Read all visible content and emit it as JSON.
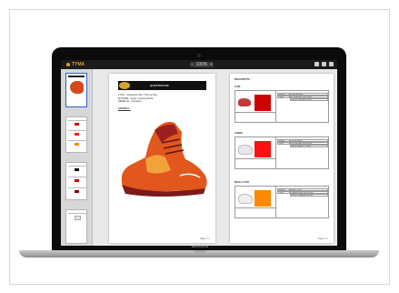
{
  "device": {
    "brand_label": "MacBook"
  },
  "app": {
    "logo_text": "TYMA",
    "zoom_controls": [
      "−",
      "100%",
      "+"
    ],
    "colors": {
      "topbar": "#1b1b1b",
      "accent": "#d6a32b"
    }
  },
  "sidebar": {
    "thumbnails": [
      {
        "kind": "cover"
      },
      {
        "kind": "colorway",
        "swatches": [
          "#d40000",
          "#ff1a1a",
          "#ff8c00"
        ]
      },
      {
        "kind": "colorway",
        "swatches": [
          "#000000",
          "#d40000",
          "#8b0000"
        ]
      },
      {
        "kind": "colorway",
        "swatches": [
          "#e6e6e6"
        ]
      }
    ]
  },
  "page1": {
    "title": "QUESTION M2",
    "description": "TYPE : Chaussure trail / Trail running\nMATIERE : Upper mesh/synthetic\nSEMELLE : Contagrip",
    "section": "APERÇU :",
    "footer": "Page 1 / 2",
    "shoe_colors": [
      "#e2571d",
      "#9b1f1f",
      "#f2a23a"
    ]
  },
  "page2": {
    "heading": "DESCRIPTIF :",
    "footer": "Page 2 / 2",
    "colorways": [
      {
        "label": "CUIR",
        "swatch": "#d10000",
        "shoe": "#c23a3a",
        "rows": [
          [
            "Matériau",
            "CUIR NATUREL"
          ],
          [
            "Coloris",
            "ROUGE PANTONE 18-1662"
          ],
          [
            "",
            "LACETS ROUGES 18-1662"
          ]
        ]
      },
      {
        "label": "SUEDE",
        "swatch": "#ff1010",
        "shoe": "#e9e9e9",
        "rows": [
          [
            "Matériau",
            "SUEDE BLANC"
          ],
          [
            "Coloris",
            "ROUGE PANTONE 18-1664"
          ],
          [
            "",
            "LACETS BLANCS 11-0601"
          ]
        ]
      },
      {
        "label": "MESH / CUIR",
        "swatch": "#ff8a00",
        "shoe": "#efefef",
        "rows": [
          [
            "Matériau",
            "MESH / CUIR"
          ],
          [
            "Coloris",
            "ORANGE PANTONE 16-1364"
          ],
          [
            "",
            "LACETS ORANGES 16-1364"
          ]
        ]
      }
    ]
  }
}
